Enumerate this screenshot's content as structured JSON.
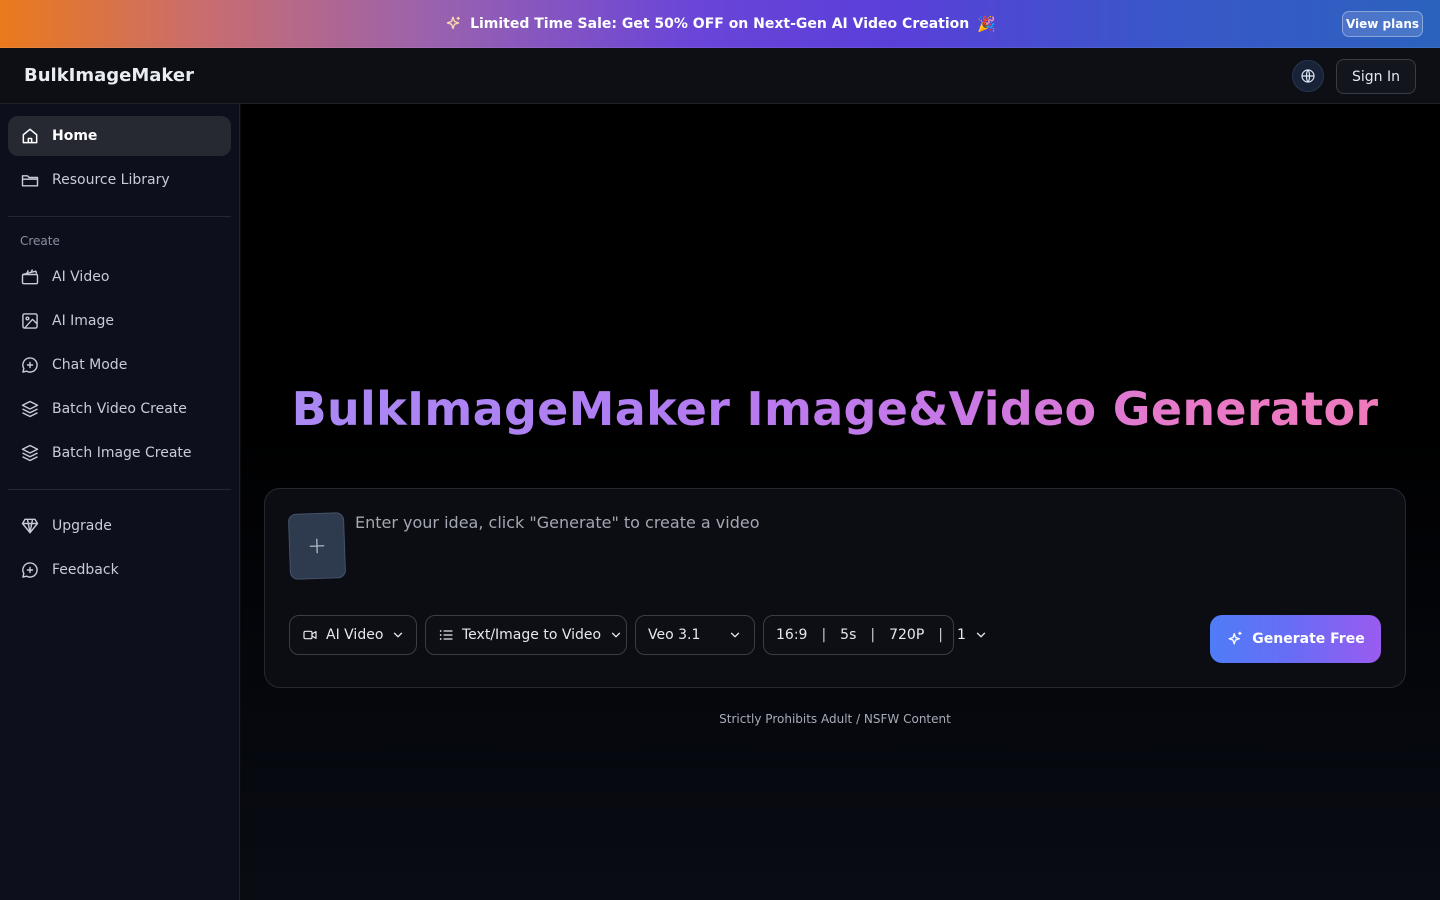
{
  "promo": {
    "sparkle_icon": "sparkle-icon",
    "text": "Limited Time Sale: Get 50% OFF on Next-Gen AI Video Creation",
    "party_emoji": "🎉",
    "button_label": "View plans"
  },
  "header": {
    "logo": "BulkImageMaker",
    "language_icon": "globe-icon",
    "signin_label": "Sign In"
  },
  "sidebar": {
    "top_items": [
      {
        "label": "Home",
        "icon": "home-icon",
        "active": true
      },
      {
        "label": "Resource Library",
        "icon": "folder-icon",
        "active": false
      }
    ],
    "create_section_label": "Create",
    "create_items": [
      {
        "label": "AI Video",
        "icon": "clapperboard-icon"
      },
      {
        "label": "AI Image",
        "icon": "image-icon"
      },
      {
        "label": "Chat Mode",
        "icon": "chat-plus-icon"
      },
      {
        "label": "Batch Video Create",
        "icon": "layers-icon"
      },
      {
        "label": "Batch Image Create",
        "icon": "layers-icon"
      }
    ],
    "bottom_items": [
      {
        "label": "Upgrade",
        "icon": "diamond-icon"
      },
      {
        "label": "Feedback",
        "icon": "feedback-icon"
      }
    ]
  },
  "main": {
    "hero_title": "BulkImageMaker Image&Video Generator",
    "composer": {
      "prompt_placeholder": "Enter your idea, click \"Generate\" to create a video",
      "prompt_value": "",
      "type_select": "AI Video",
      "mode_select": "Text/Image to Video",
      "model_select": "Veo 3.1",
      "params": {
        "ratio": "16:9",
        "duration": "5s",
        "resolution": "720P",
        "count": "1"
      },
      "generate_label": "Generate Free"
    },
    "notice": "Strictly Prohibits Adult / NSFW Content"
  },
  "colors": {
    "accent_start": "#4f7cf7",
    "accent_end": "#9a5bf0",
    "title_start": "#a98bf4",
    "title_end": "#f07ab8"
  }
}
